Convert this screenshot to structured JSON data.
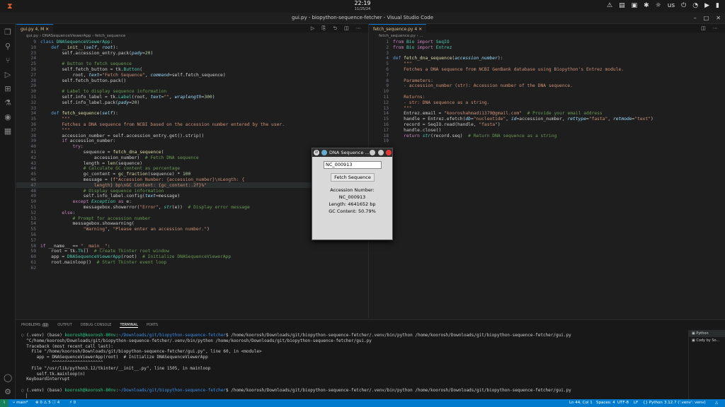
{
  "topbar": {
    "clock": "22:19",
    "date": "11/25/24",
    "lang": "us"
  },
  "window": {
    "title": "gui.py - biopython-sequence-fetcher - Visual Studio Code"
  },
  "left_tab": {
    "label": "gui.py 4, M"
  },
  "left_crumb": "gui.py  ›  DNASequenceViewerApp  ›  fetch_sequence",
  "right_tab": {
    "label": "fetch_sequence.py 4"
  },
  "right_crumb": "fetch_sequence.py  ›  ...",
  "left_lines": [
    {
      "n": "9",
      "h": "<span class='kw'>class</span> <span class='cls'>DNASequenceViewerApp</span>:"
    },
    {
      "n": "10",
      "h": "    <span class='kw'>def</span> <span class='fn'>__init__</span>(<span class='var it'>self</span>, <span class='var it'>root</span>):"
    },
    {
      "n": "23",
      "h": "        self.accession_entry.pack(<span class='var it'>pady</span>=<span class='num'>20</span>)"
    },
    {
      "n": "24",
      "h": ""
    },
    {
      "n": "25",
      "h": "        <span class='cm'># Button to fetch sequence</span>"
    },
    {
      "n": "26",
      "h": "        self.fetch_button = tk.<span class='cls'>Button</span>("
    },
    {
      "n": "27",
      "h": "            root, <span class='var it'>text</span>=<span class='str'>\"Fetch Sequence\"</span>, <span class='var it'>command</span>=self.fetch_sequence)"
    },
    {
      "n": "28",
      "h": "        self.fetch_button.pack()"
    },
    {
      "n": "29",
      "h": ""
    },
    {
      "n": "30",
      "h": "        <span class='cm'># Label to display sequence information</span>"
    },
    {
      "n": "31",
      "h": "        self.info_label = tk.<span class='cls'>Label</span>(root, <span class='var it'>text</span>=<span class='str'>\"\"</span>, <span class='var it'>wraplength</span>=<span class='num'>300</span>)"
    },
    {
      "n": "32",
      "h": "        self.info_label.pack(<span class='var it'>pady</span>=<span class='num'>20</span>)"
    },
    {
      "n": "33",
      "h": ""
    },
    {
      "n": "34",
      "h": "    <span class='kw'>def</span> <span class='fn'>fetch_sequence</span>(<span class='var it'>self</span>):"
    },
    {
      "n": "35",
      "h": "        <span class='str'>\"\"\"</span>"
    },
    {
      "n": "36",
      "h": "<span class='str'>        Fetches a DNA sequence from NCBI based on the accession number entered by the user.</span>"
    },
    {
      "n": "37",
      "h": "        <span class='str'>\"\"\"</span>"
    },
    {
      "n": "38",
      "h": "        accession_number = self.accession_entry.get().strip()"
    },
    {
      "n": "39",
      "h": "        <span class='kc'>if</span> accession_number:"
    },
    {
      "n": "40",
      "h": "            <span class='kc'>try</span>:"
    },
    {
      "n": "41",
      "h": "                sequence = <span class='fn'>fetch_dna_sequence</span>("
    },
    {
      "n": "42",
      "h": "                    accession_number)  <span class='cm'># Fetch DNA sequence</span>"
    },
    {
      "n": "43",
      "h": "                length = <span class='fn'>len</span>(sequence)"
    },
    {
      "n": "44",
      "h": "                <span class='cm'># Calculate GC content as percentage</span>"
    },
    {
      "n": "45",
      "h": "                gc_content = <span class='fn'>gc_fraction</span>(sequence) * <span class='num'>100</span>"
    },
    {
      "n": "46",
      "h": "                message = (<span class='str'>f\"Accession Number: {accession_number}\\nLength: {</span>"
    },
    {
      "n": "47",
      "h": "<span class='str'>                    length} bp\\nGC Content: {gc_content:.2f}%\"</span>"
    },
    {
      "n": "48",
      "h": "                <span class='cm'># Display sequence information</span>"
    },
    {
      "n": "49",
      "h": "                self.info_label.config(<span class='var it'>text</span>=message)"
    },
    {
      "n": "50",
      "h": "            <span class='kc'>except</span> <span class='cls it'>Exception</span> <span class='kc'>as</span> e:"
    },
    {
      "n": "51",
      "h": "                messagebox.showerror(<span class='str'>\"Error\"</span>, <span class='cls it'>str</span>(e))  <span class='cm'># Display error message</span>"
    },
    {
      "n": "52",
      "h": "        <span class='kc'>else</span>:"
    },
    {
      "n": "53",
      "h": "            <span class='cm'># Prompt for accession number</span>"
    },
    {
      "n": "54",
      "h": "            messagebox.showwarning("
    },
    {
      "n": "55",
      "h": "                <span class='str'>\"Warning\"</span>, <span class='str'>\"Please enter an accession number.\"</span>)"
    },
    {
      "n": "56",
      "h": ""
    },
    {
      "n": "57",
      "h": ""
    },
    {
      "n": "58",
      "h": "<span class='kc'>if</span> __name__ == <span class='str'>\"__main__\"</span>:"
    },
    {
      "n": "59",
      "h": "    root = tk.<span class='cls'>Tk</span>()  <span class='cm'># Create Tkinter root window</span>"
    },
    {
      "n": "60",
      "h": "    app = <span class='cls'>DNASequenceViewerApp</span>(root)  <span class='cm'># Initialize DNASequenceViewerApp</span>"
    },
    {
      "n": "61",
      "h": "    root.mainloop()  <span class='cm'># Start Tkinter event loop</span>"
    },
    {
      "n": "62",
      "h": ""
    }
  ],
  "right_lines": [
    {
      "n": "1",
      "h": "<span class='kc'>from</span> <span class='cls'>Bio</span> <span class='kc'>import</span> <span class='cls'>SeqIO</span>"
    },
    {
      "n": "2",
      "h": "<span class='kc'>from</span> <span class='cls'>Bio</span> <span class='kc'>import</span> <span class='cls'>Entrez</span>"
    },
    {
      "n": "3",
      "h": ""
    },
    {
      "n": "4",
      "h": "<span class='kw'>def</span> <span class='fn'>fetch_dna_sequence</span>(<span class='var it'>accession_number</span>):"
    },
    {
      "n": "5",
      "h": "    <span class='str'>\"\"\"</span>"
    },
    {
      "n": "6",
      "h": "<span class='str'>    Fetches a DNA sequence from NCBI GenBank database using Biopython's Entrez module.</span>"
    },
    {
      "n": "7",
      "h": ""
    },
    {
      "n": "8",
      "h": "<span class='str'>    Parameters:</span>"
    },
    {
      "n": "9",
      "h": "<span class='str'>    - accession_number (str): Accession number of the DNA sequence.</span>"
    },
    {
      "n": "10",
      "h": ""
    },
    {
      "n": "11",
      "h": "<span class='str'>    Returns:</span>"
    },
    {
      "n": "12",
      "h": "<span class='str'>    - str: DNA sequence as a string.</span>"
    },
    {
      "n": "13",
      "h": "    <span class='str'>\"\"\"</span>"
    },
    {
      "n": "14",
      "h": "    Entrez.email = <span class='str'>\"kooroshahmadi1379@gmail.com\"</span>  <span class='cm'># Provide your email address</span>"
    },
    {
      "n": "15",
      "h": "    handle = Entrez.efetch(<span class='var it'>db</span>=<span class='str'>\"nucleotide\"</span>, <span class='var it'>id</span>=accession_number, <span class='var it'>rettype</span>=<span class='str'>\"fasta\"</span>, <span class='var it'>retmode</span>=<span class='str'>\"text\"</span>)"
    },
    {
      "n": "16",
      "h": "    record = SeqIO.read(handle, <span class='str'>\"fasta\"</span>)"
    },
    {
      "n": "17",
      "h": "    handle.close()"
    },
    {
      "n": "18",
      "h": "    <span class='kc'>return</span> <span class='cls it'>str</span>(record.seq)  <span class='cm'># Return DNA sequence as a string</span>"
    },
    {
      "n": "19",
      "h": ""
    }
  ],
  "panel": {
    "tabs": [
      "PROBLEMS",
      "OUTPUT",
      "DEBUG CONSOLE",
      "TERMINAL",
      "PORTS"
    ],
    "problems_count": "12",
    "active": "TERMINAL",
    "terminals": [
      "Python",
      "Cody by So..."
    ]
  },
  "terminal_lines": [
    "<span style='color:#888'>○</span> (.venv) (base) <span class='pg'>koorosh@koorosh-80nv</span>:<span class='pb'>~/Downloads/git/biopython-sequence-fetcher</span>$ /home/koorosh/Downloads/git/biopython-sequence-fetcher/.venv/bin/python /home/koorosh/Downloads/git/biopython-sequence-fetcher/gui.py",
    "  ^C/home/koorosh/Downloads/git/biopython-sequence-fetcher/.venv/bin/python /home/koorosh/Downloads/git/biopython-sequence-fetcher/gui.py",
    "  Traceback (most recent call last):",
    "    File \"/home/koorosh/Downloads/git/biopython-sequence-fetcher/gui.py\", line 60, in &lt;module&gt;",
    "      app = DNASequenceViewerApp(root)  # Initialize DNASequenceViewerApp",
    "            ^^^^^^^^^^^^^^^^^^^^",
    "    File \"/usr/lib/python3.12/tkinter/__init__.py\", line 1505, in mainloop",
    "      self.tk.mainloop(n)",
    "  KeyboardInterrupt",
    "",
    "<span style='color:#888'>○</span> (.venv) (base) <span class='pg'>koorosh@koorosh-80nv</span>:<span class='pb'>~/Downloads/git/biopython-sequence-fetcher</span>$ /home/koorosh/Downloads/git/biopython-sequence-fetcher/.venv/bin/python /home/koorosh/Downloads/git/biopython-sequence-fetcher/gui.py",
    "  ▏"
  ],
  "status": {
    "branch": "main*",
    "errors": "⊗ 0 ⚠ 5 ⓘ 4",
    "ports": "⚡ 0",
    "position": "Ln 44, Col 1",
    "spaces": "Spaces: 4",
    "encoding": "UTF-8",
    "eol": "LF",
    "lang": "{} Python",
    "interp": "3.12.7 ('.venv': venv)"
  },
  "dialog": {
    "title": "DNA Sequence ...",
    "entry": "NC_000913",
    "button": "Fetch Sequence",
    "info": [
      "Accession Number:",
      "NC_000913",
      "Length: 4641652 bp",
      "GC Content: 50.79%"
    ]
  }
}
